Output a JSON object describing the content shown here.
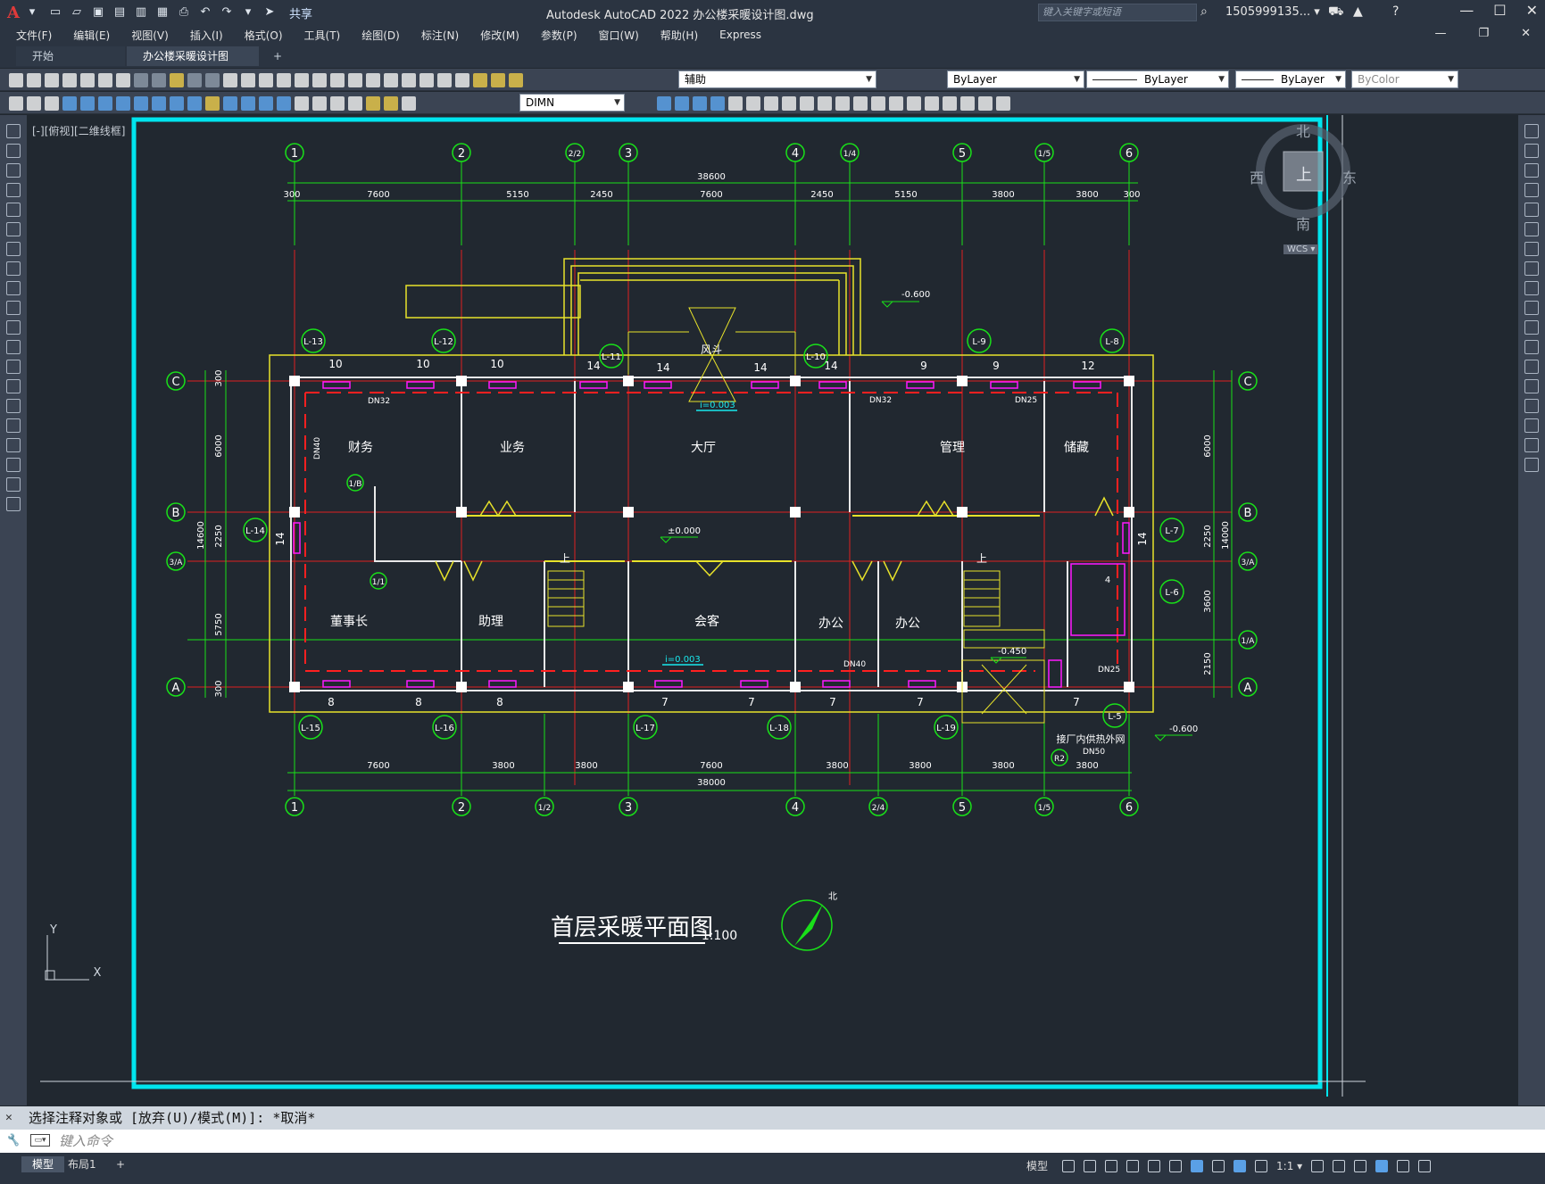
{
  "app": {
    "logo": "A",
    "title": "Autodesk AutoCAD 2022    办公楼采暖设计图.dwg",
    "share_label": "共享",
    "search_placeholder": "键入关键字或短语",
    "user": "1505999135... ▾"
  },
  "menu": [
    "文件(F)",
    "编辑(E)",
    "视图(V)",
    "插入(I)",
    "格式(O)",
    "工具(T)",
    "绘图(D)",
    "标注(N)",
    "修改(M)",
    "参数(P)",
    "窗口(W)",
    "帮助(H)",
    "Express"
  ],
  "tabs": {
    "start": "开始",
    "doc": "办公楼采暖设计图*",
    "close": "×",
    "plus": "+"
  },
  "toolbar": {
    "layer": "辅助",
    "color": "ByLayer",
    "linetype": "ByLayer",
    "lineweight": "ByLayer",
    "plotstyle": "ByColor",
    "dimstyle": "DIMN"
  },
  "viewport": {
    "control_label": "[-][俯视][二维线框]"
  },
  "viewcube": {
    "north": "北",
    "south": "南",
    "east": "东",
    "west": "西",
    "top": "上",
    "wcs": "WCS ▾"
  },
  "drawing": {
    "title": "首层采暖平面图",
    "scale": "1:100",
    "north_arrow_label": "北",
    "grid_top": [
      "1",
      "2",
      "2/2",
      "3",
      "4",
      "1/4",
      "5",
      "1/5",
      "6"
    ],
    "grid_bottom": [
      "1",
      "2",
      "1/2",
      "3",
      "4",
      "2/4",
      "5",
      "1/5",
      "6"
    ],
    "grid_rows_left": [
      "C",
      "B",
      "3/A",
      "A"
    ],
    "grid_rows_right": [
      "C",
      "B",
      "3/A",
      "1/A",
      "A"
    ],
    "top_total": "38600",
    "top_dims": [
      "300",
      "7600",
      "5150",
      "2450",
      "7600",
      "2450",
      "5150",
      "3800",
      "3800",
      "300"
    ],
    "bottom_dims": [
      "7600",
      "3800",
      "3800",
      "7600",
      "3800",
      "3800",
      "3800",
      "3800"
    ],
    "bottom_total": "38000",
    "left_dims": [
      "300",
      "6000",
      "14600",
      "2250",
      "5750",
      "300"
    ],
    "right_dims": [
      "6000",
      "2250",
      "14000",
      "3600",
      "2150"
    ],
    "rooms": [
      "财务",
      "业务",
      "大厅",
      "管理",
      "储藏",
      "董事长",
      "助理",
      "会客",
      "办公",
      "办公",
      "风斗"
    ],
    "risers": [
      "L-13",
      "L-12",
      "L-11",
      "L-10",
      "L-9",
      "L-8",
      "L-14",
      "L-7",
      "L-6",
      "L-15",
      "L-16",
      "L-17",
      "L-18",
      "L-19",
      "L-5"
    ],
    "levels": [
      "-0.600",
      "±0.000",
      "-0.450",
      "-0.600"
    ],
    "slopes": [
      "i=0.003",
      "i=0.003"
    ],
    "pipe_labels": [
      "DN32",
      "DN32",
      "DN25",
      "DN40",
      "DN40",
      "DN25",
      "DN50"
    ],
    "radiator_counts_top": [
      "10",
      "10",
      "10",
      "14",
      "14",
      "14",
      "14",
      "9",
      "9",
      "12"
    ],
    "radiator_counts_bottom": [
      "8",
      "8",
      "8",
      "7",
      "7",
      "7",
      "7",
      "7"
    ],
    "side_counts": [
      "14",
      "14",
      "4"
    ],
    "sub_grids": [
      "1/B",
      "1/1",
      "R2"
    ],
    "stairs": [
      "上",
      "上"
    ],
    "external": "接厂内供热外网",
    "ucs_y": "Y",
    "ucs_x": "X"
  },
  "command": {
    "history": "选择注释对象或 [放弃(U)/模式(M)]: *取消*",
    "placeholder": "键入命令",
    "icon": "▭▾"
  },
  "status": {
    "model_tab": "模型",
    "layout_tab": "布局1",
    "plus": "+",
    "model_label": "模型",
    "scale": "1:1 ▾"
  }
}
